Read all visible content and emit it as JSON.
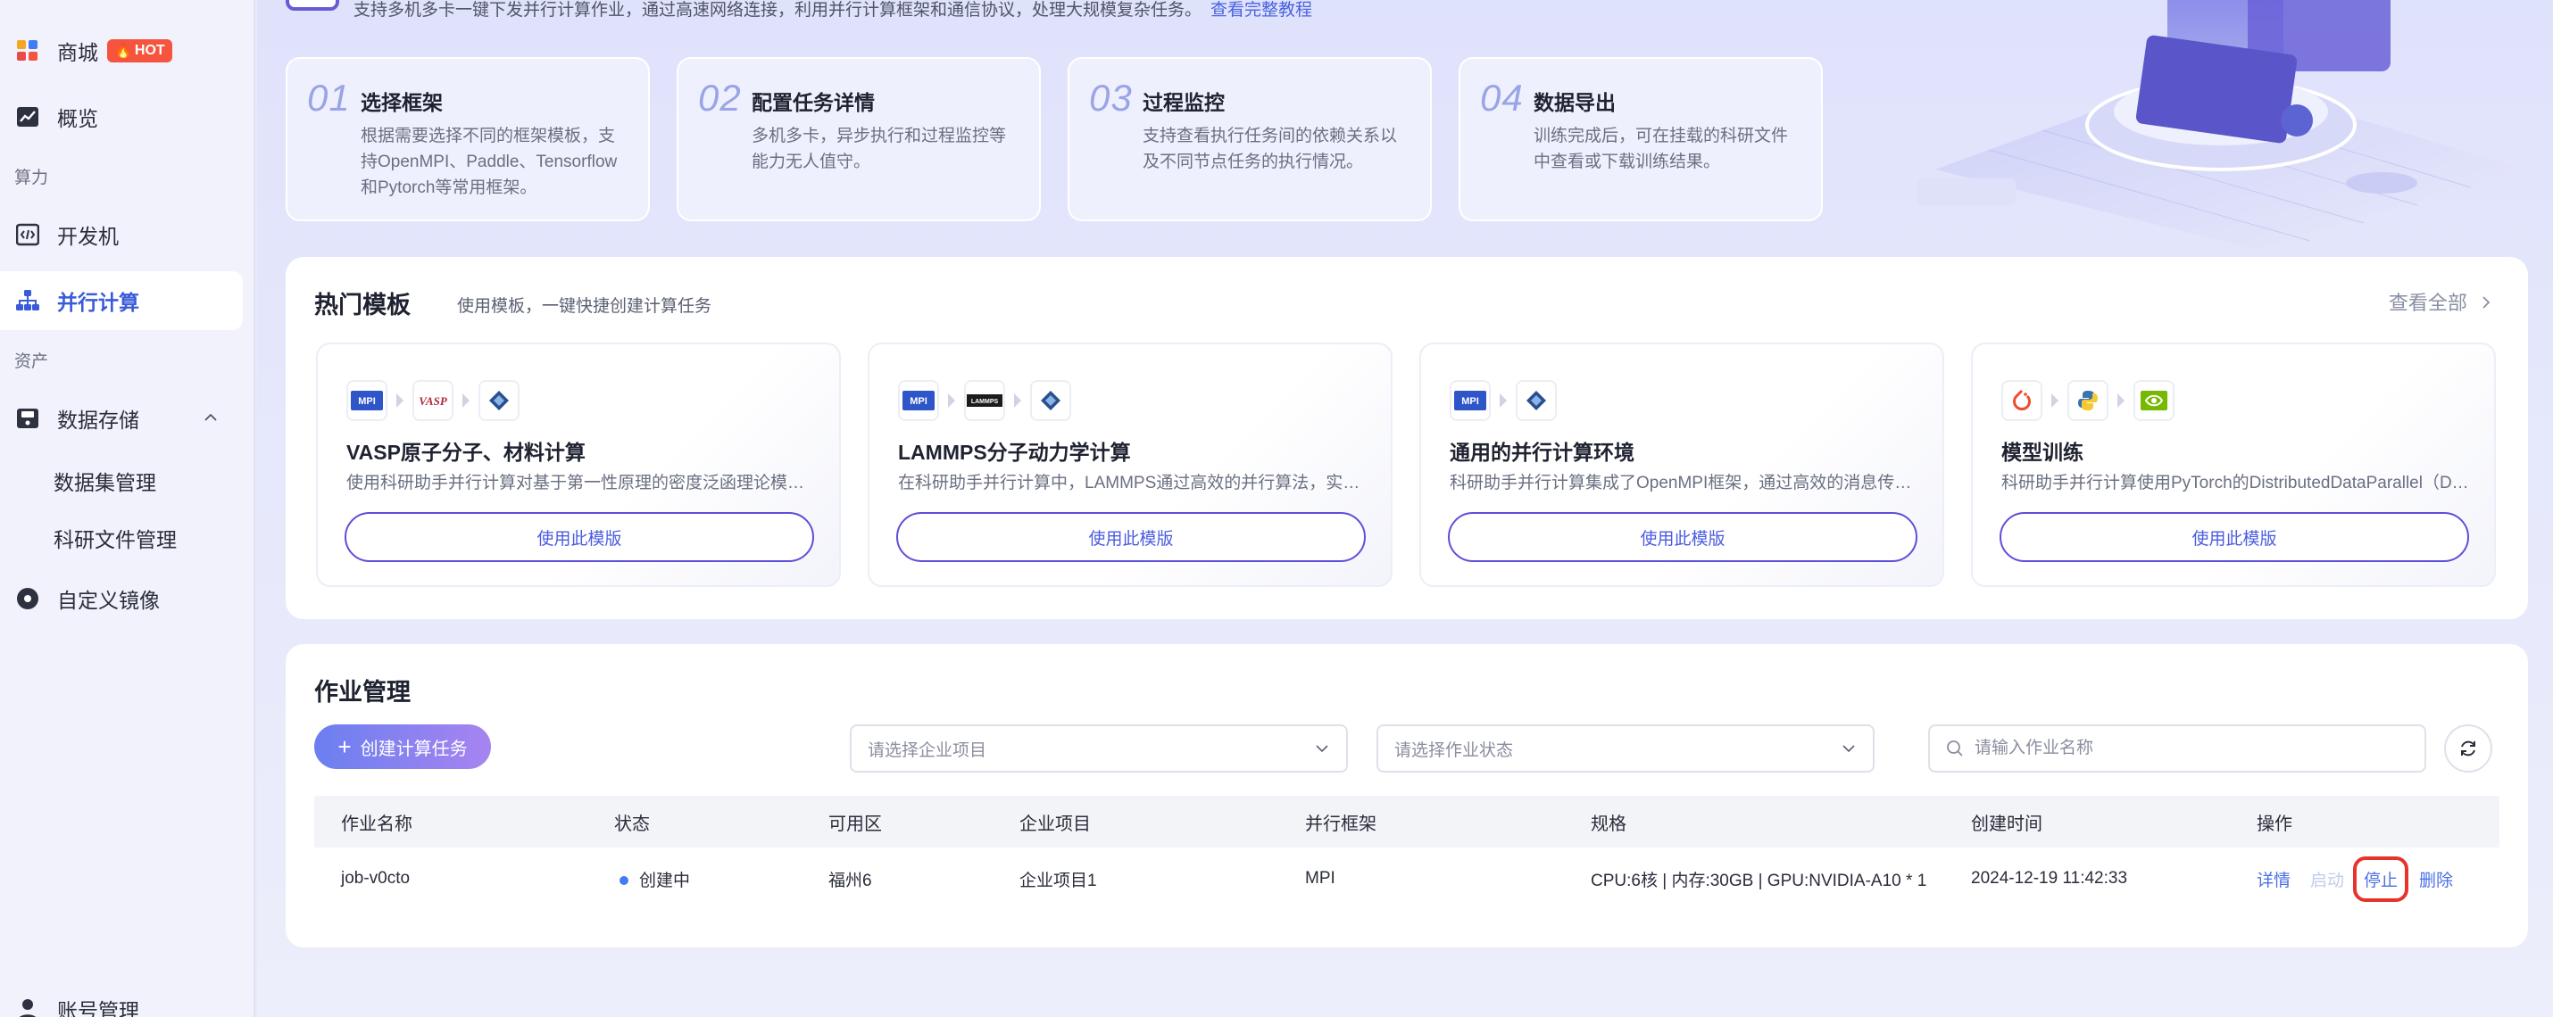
{
  "sidebar": {
    "items": [
      {
        "label": "商城",
        "badge": "HOT"
      },
      {
        "label": "概览"
      },
      {
        "label": "开发机"
      },
      {
        "label": "并行计算"
      },
      {
        "label": "数据存储"
      },
      {
        "label": "自定义镜像"
      },
      {
        "label": "账号管理"
      }
    ],
    "groups": [
      "算力",
      "资产"
    ],
    "sub_items": [
      "数据集管理",
      "科研文件管理"
    ]
  },
  "intro": {
    "text": "支持多机多卡一键下发并行计算作业，通过高速网络连接，利用并行计算框架和通信协议，处理大规模复杂任务。",
    "link": "查看完整教程"
  },
  "steps": [
    {
      "num": "01",
      "title": "选择框架",
      "desc": "根据需要选择不同的框架模板，支持OpenMPI、Paddle、Tensorflow和Pytorch等常用框架。"
    },
    {
      "num": "02",
      "title": "配置任务详情",
      "desc": "多机多卡，异步执行和过程监控等能力无人值守。"
    },
    {
      "num": "03",
      "title": "过程监控",
      "desc": "支持查看执行任务间的依赖关系以及不同节点任务的执行情况。"
    },
    {
      "num": "04",
      "title": "数据导出",
      "desc": "训练完成后，可在挂载的科研文件中查看或下载训练结果。"
    }
  ],
  "hot_templates": {
    "title": "热门模板",
    "subtitle": "使用模板，一键快捷创建计算任务",
    "view_all": "查看全部",
    "use_label": "使用此模版",
    "items": [
      {
        "name": "VASP原子分子、材料计算",
        "desc": "使用科研助手并行计算对基于第一性原理的密度泛函理论模拟计算进行加速",
        "icons": [
          "MPI",
          "VASP"
        ]
      },
      {
        "name": "LAMMPS分子动力学计算",
        "desc": "在科研助手并行计算中，LAMMPS通过高效的并行算法，实现大规模分子动力学模拟",
        "icons": [
          "MPI",
          "LAMMPS"
        ]
      },
      {
        "name": "通用的并行计算环境",
        "desc": "科研助手并行计算集成了OpenMPI框架，通过高效的消息传递接口实现通用的并行计算",
        "icons": [
          "MPI"
        ]
      },
      {
        "name": "模型训练",
        "desc": "科研助手并行计算使用PyTorch的DistributedDataParallel（DDP）进行模型训练",
        "icons": []
      }
    ]
  },
  "jobs": {
    "title": "作业管理",
    "create_label": "创建计算任务",
    "project_placeholder": "请选择企业项目",
    "status_placeholder": "请选择作业状态",
    "search_placeholder": "请输入作业名称",
    "columns": [
      "作业名称",
      "状态",
      "可用区",
      "企业项目",
      "并行框架",
      "规格",
      "创建时间",
      "操作"
    ],
    "rows": [
      {
        "name": "job-v0cto",
        "status": "创建中",
        "zone": "福州6",
        "project": "企业项目1",
        "framework": "MPI",
        "spec": "CPU:6核 | 内存:30GB | GPU:NVIDIA-A10 * 1",
        "created": "2024-12-19 11:42:33",
        "ops": [
          "详情",
          "启动",
          "停止",
          "删除"
        ]
      }
    ]
  },
  "colors": {
    "accent": "#4a63e0",
    "status_dot": "#3f7cf6",
    "hot": "#f5553e",
    "highlight": "#e4342c"
  }
}
